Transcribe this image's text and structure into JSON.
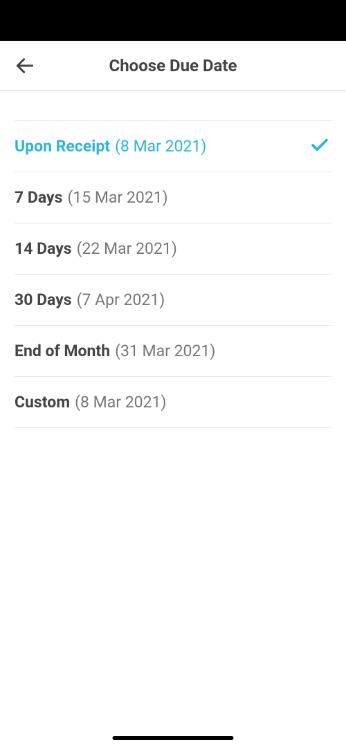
{
  "header": {
    "title": "Choose Due Date"
  },
  "options": [
    {
      "label": "Upon Receipt",
      "date": "(8 Mar 2021)",
      "selected": true
    },
    {
      "label": "7 Days",
      "date": "(15 Mar 2021)",
      "selected": false
    },
    {
      "label": "14 Days",
      "date": "(22 Mar 2021)",
      "selected": false
    },
    {
      "label": "30 Days",
      "date": "(7 Apr 2021)",
      "selected": false
    },
    {
      "label": "End of Month",
      "date": "(31 Mar 2021)",
      "selected": false
    },
    {
      "label": "Custom",
      "date": "(8 Mar 2021)",
      "selected": false
    }
  ]
}
